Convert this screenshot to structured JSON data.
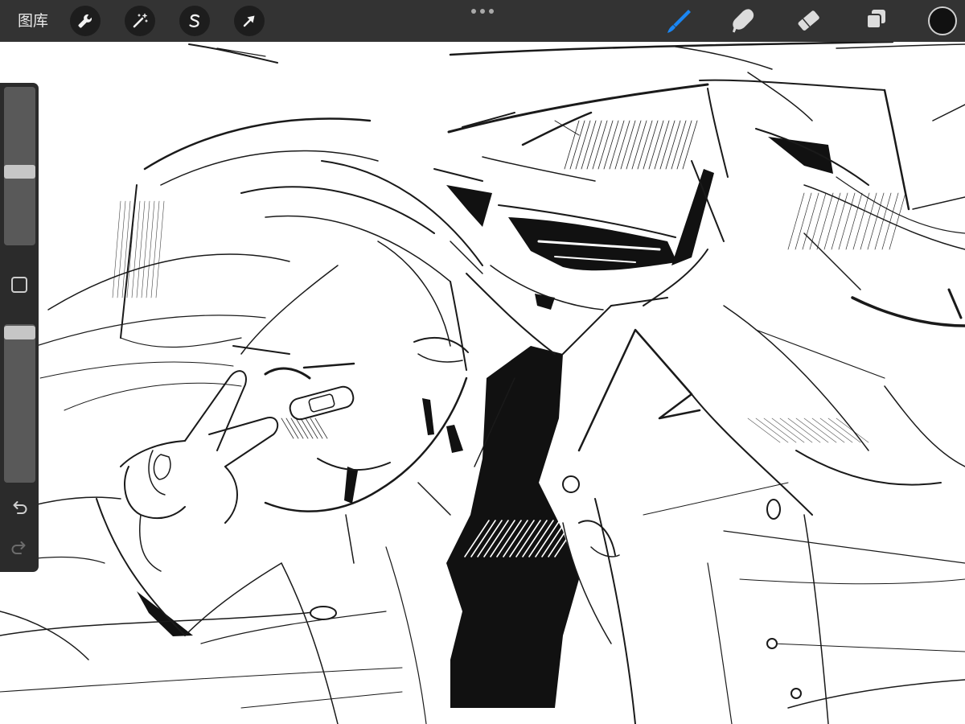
{
  "toolbar": {
    "gallery_label": "图库",
    "more_icon": "more-dots-icon",
    "left_tools": [
      "wrench-icon",
      "magic-wand-icon",
      "selection-icon",
      "transform-arrow-icon"
    ],
    "right_tools": [
      "brush-icon",
      "smudge-icon",
      "eraser-icon",
      "layers-icon"
    ],
    "active_tool": "brush-icon"
  },
  "current_color": "#111111",
  "colors": {
    "toolbar_bg": "#333333",
    "sidebar_bg": "#2b2b2b",
    "accent": "#1b86f2",
    "icon": "#dcdcdc",
    "canvas": "#ffffff"
  },
  "sidebar": {
    "brush_size": 0.46,
    "opacity": 0.99,
    "modify_icon": "square-icon",
    "undo_icon": "undo-icon",
    "redo_icon": "redo-icon",
    "redo_enabled": false
  }
}
